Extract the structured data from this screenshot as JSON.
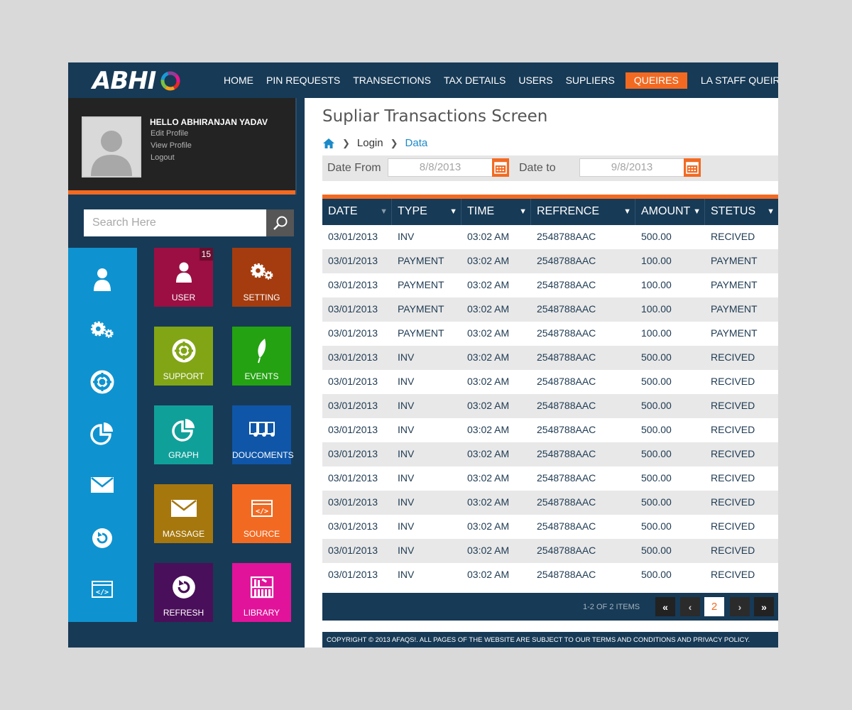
{
  "logo": {
    "text": "ABHI"
  },
  "nav": {
    "items": [
      "HOME",
      "PIN REQUESTS",
      "TRANSECTIONS",
      "TAX DETAILS",
      "USERS",
      "SUPLIERS",
      "QUEIRES",
      "LA STAFF QUEIRES"
    ],
    "active": "QUEIRES",
    "caret": "▼"
  },
  "profile": {
    "hello": "HELLO ABHIRANJAN YADAV",
    "links": [
      "Edit Profile",
      "View Profile",
      "Logout"
    ]
  },
  "search": {
    "placeholder": "Search Here"
  },
  "icon_column": [
    "user-icon",
    "settings-icon",
    "support-icon",
    "graph-icon",
    "mail-icon",
    "refresh-icon",
    "source-code-icon"
  ],
  "tiles": [
    {
      "label": "USER",
      "icon": "user-icon",
      "color": "#9b0f43",
      "badge": "15"
    },
    {
      "label": "SETTING",
      "icon": "settings-icon",
      "color": "#a43c0f"
    },
    {
      "label": "SUPPORT",
      "icon": "support-icon",
      "color": "#82a516"
    },
    {
      "label": "EVENTS",
      "icon": "leaf-icon",
      "color": "#24a212"
    },
    {
      "label": "GRAPH",
      "icon": "graph-icon",
      "color": "#10a09a"
    },
    {
      "label": "DOUCOMENTS",
      "icon": "documents-icon",
      "color": "#0f56a8"
    },
    {
      "label": "MASSAGE",
      "icon": "mail-icon",
      "color": "#a5770d"
    },
    {
      "label": "SOURCE",
      "icon": "source-code-icon",
      "color": "#f26a22"
    },
    {
      "label": "REFRESH",
      "icon": "refresh-icon",
      "color": "#4a0f5a"
    },
    {
      "label": "LIBRARY",
      "icon": "library-icon",
      "color": "#e1139a"
    }
  ],
  "content": {
    "title": "Supliar Transactions Screen",
    "breadcrumb": {
      "login": "Login",
      "data": "Data"
    },
    "filters": {
      "from_label": "Date From",
      "from_value": "8/8/2013",
      "to_label": "Date to",
      "to_value": "9/8/2013"
    }
  },
  "table": {
    "columns": [
      "DATE",
      "TYPE",
      "TIME",
      "REFRENCE",
      "AMOUNT",
      "STETUS"
    ],
    "rows": [
      [
        "03/01/2013",
        "INV",
        "03:02 AM",
        "2548788AAC",
        "500.00",
        "RECIVED"
      ],
      [
        "03/01/2013",
        "PAYMENT",
        "03:02 AM",
        "2548788AAC",
        "100.00",
        "PAYMENT"
      ],
      [
        "03/01/2013",
        "PAYMENT",
        "03:02 AM",
        "2548788AAC",
        "100.00",
        "PAYMENT"
      ],
      [
        "03/01/2013",
        "PAYMENT",
        "03:02 AM",
        "2548788AAC",
        "100.00",
        "PAYMENT"
      ],
      [
        "03/01/2013",
        "PAYMENT",
        "03:02 AM",
        "2548788AAC",
        "100.00",
        "PAYMENT"
      ],
      [
        "03/01/2013",
        "INV",
        "03:02 AM",
        "2548788AAC",
        "500.00",
        "RECIVED"
      ],
      [
        "03/01/2013",
        "INV",
        "03:02 AM",
        "2548788AAC",
        "500.00",
        "RECIVED"
      ],
      [
        "03/01/2013",
        "INV",
        "03:02 AM",
        "2548788AAC",
        "500.00",
        "RECIVED"
      ],
      [
        "03/01/2013",
        "INV",
        "03:02 AM",
        "2548788AAC",
        "500.00",
        "RECIVED"
      ],
      [
        "03/01/2013",
        "INV",
        "03:02 AM",
        "2548788AAC",
        "500.00",
        "RECIVED"
      ],
      [
        "03/01/2013",
        "INV",
        "03:02 AM",
        "2548788AAC",
        "500.00",
        "RECIVED"
      ],
      [
        "03/01/2013",
        "INV",
        "03:02 AM",
        "2548788AAC",
        "500.00",
        "RECIVED"
      ],
      [
        "03/01/2013",
        "INV",
        "03:02 AM",
        "2548788AAC",
        "500.00",
        "RECIVED"
      ],
      [
        "03/01/2013",
        "INV",
        "03:02 AM",
        "2548788AAC",
        "500.00",
        "RECIVED"
      ],
      [
        "03/01/2013",
        "INV",
        "03:02 AM",
        "2548788AAC",
        "500.00",
        "RECIVED"
      ]
    ]
  },
  "pager": {
    "info": "1-2 OF 2 ITEMS",
    "first": "«",
    "prev": "‹",
    "current": "2",
    "next": "›",
    "last": "»"
  },
  "footer": {
    "text": "COPYRIGHT © 2013 AFAQS!. ALL PAGES OF THE WEBSITE ARE SUBJECT TO OUR TERMS AND CONDITIONS AND PRIVACY POLICY."
  },
  "colors": {
    "brand_dark": "#173a56",
    "accent": "#f26a22",
    "sidebar_blue": "#0e93d0"
  }
}
